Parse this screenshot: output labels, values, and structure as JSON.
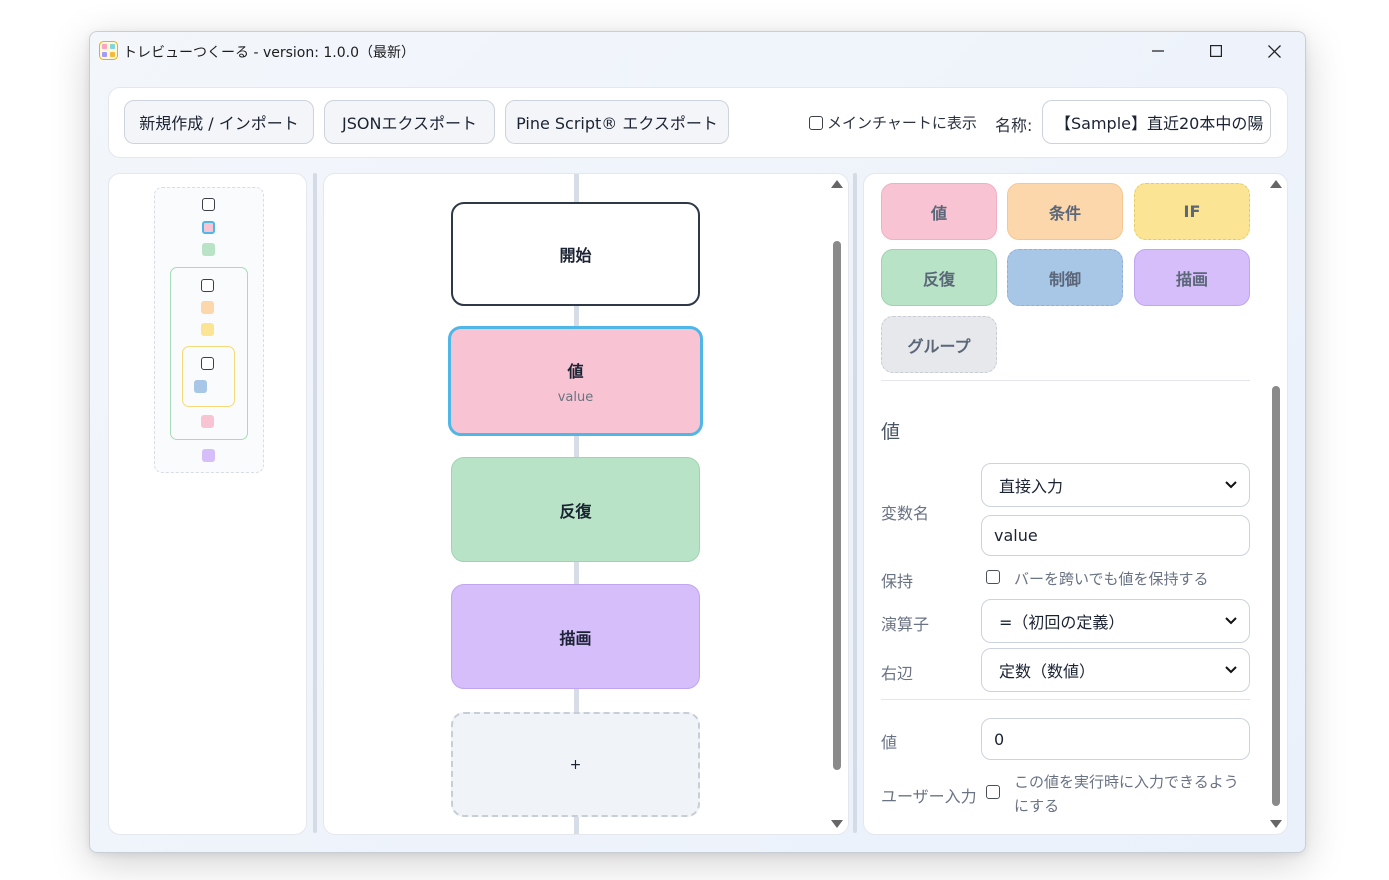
{
  "window": {
    "title": "トレビューつくーる - version: 1.0.0（最新）",
    "controls": [
      "minimize",
      "maximize",
      "close"
    ]
  },
  "toolbar": {
    "new_import": "新規作成 / インポート",
    "json_export": "JSONエクスポート",
    "pine_export": "Pine Script® エクスポート",
    "main_chart_label": "メインチャートに表示",
    "main_chart_checked": false,
    "name_label": "名称:",
    "name_value": "【Sample】直近20本中の陽"
  },
  "canvas": {
    "nodes": [
      {
        "title": "開始",
        "subtitle": "",
        "color": "#ffffff"
      },
      {
        "title": "値",
        "subtitle": "value",
        "color": "#f8c4d3",
        "selected": true
      },
      {
        "title": "反復",
        "subtitle": "",
        "color": "#b8e3c6"
      },
      {
        "title": "描画",
        "subtitle": "",
        "color": "#d5befa"
      },
      {
        "title": "+",
        "subtitle": "",
        "color": "#f0f3f7"
      }
    ]
  },
  "palette": [
    {
      "label": "値",
      "color": "#f8c4d3"
    },
    {
      "label": "条件",
      "color": "#fdd7ac"
    },
    {
      "label": "IF",
      "color": "#fbe493"
    },
    {
      "label": "反復",
      "color": "#b8e3c6"
    },
    {
      "label": "制御",
      "color": "#a8c6e6"
    },
    {
      "label": "描画",
      "color": "#d5befa"
    },
    {
      "label": "グループ",
      "color": "#e6e8ec"
    }
  ],
  "props": {
    "section_title": "値",
    "variable_label": "変数名",
    "variable_mode": "直接入力",
    "variable_name": "value",
    "keep_label": "保持",
    "keep_text": "バーを跨いでも値を保持する",
    "keep_checked": false,
    "operator_label": "演算子",
    "operator_value": "=（初回の定義）",
    "rhs_label": "右辺",
    "rhs_value": "定数（数値）",
    "value_label": "値",
    "value_value": "0",
    "user_input_label": "ユーザー入力",
    "user_input_text_1": "この値を実行時に入力できるよう",
    "user_input_text_2": "にする",
    "user_input_checked": false
  }
}
